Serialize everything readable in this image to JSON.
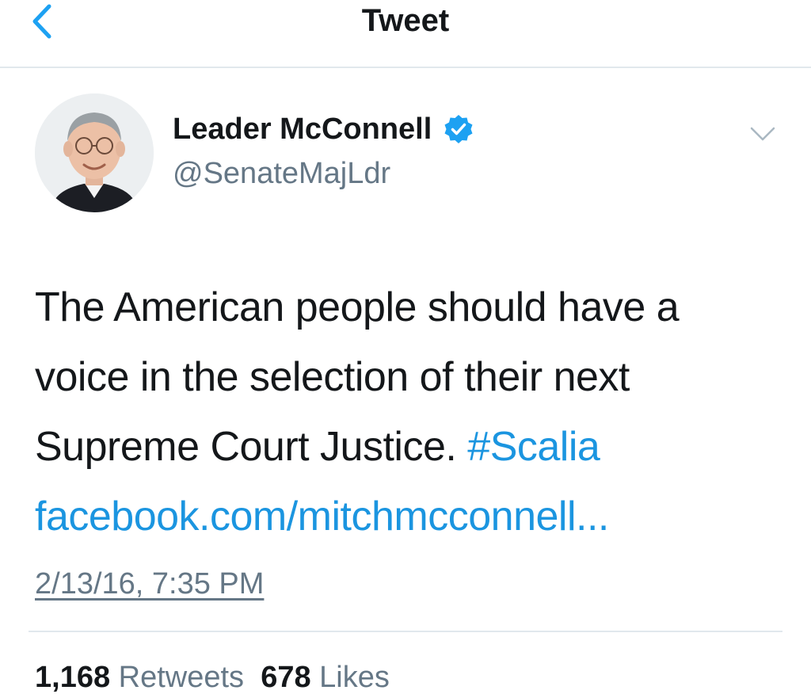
{
  "navbar": {
    "title": "Tweet",
    "back_icon": "chevron-left-icon"
  },
  "author": {
    "name": "Leader McConnell",
    "handle": "@SenateMajLdr",
    "verified": true,
    "verified_icon": "verified-badge-icon",
    "more_icon": "chevron-down-icon"
  },
  "tweet": {
    "line1": "The American people should have a",
    "line2": "voice in the selection of their next",
    "line3_text": "Supreme Court Justice. ",
    "hashtag": "#Scalia",
    "link": "facebook.com/mitchmcconnell..."
  },
  "timestamp": "2/13/16, 7:35 PM",
  "stats": {
    "retweets_count": "1,168",
    "retweets_label": "Retweets",
    "likes_count": "678",
    "likes_label": "Likes"
  },
  "colors": {
    "accent": "#1da1f2",
    "link": "#1b95e0",
    "secondary_text": "#657786",
    "primary_text": "#14171a",
    "divider": "#e1e8ed"
  }
}
